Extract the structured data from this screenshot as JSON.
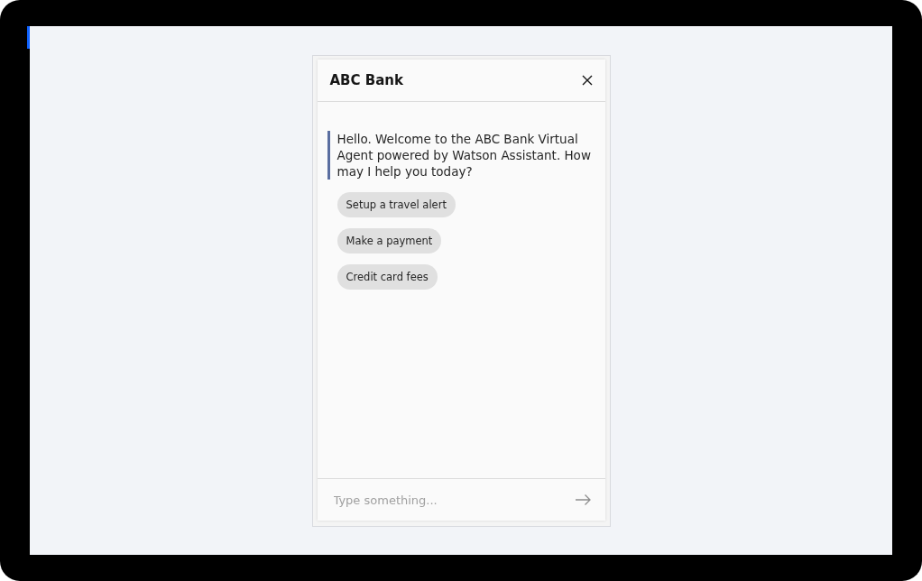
{
  "chat": {
    "title": "ABC Bank",
    "messages": [
      {
        "text": "Hello. Welcome to the ABC Bank Virtual Agent powered by Watson Assistant. How may I help you today?",
        "options": [
          "Setup a travel alert",
          "Make a payment",
          "Credit card fees"
        ]
      }
    ],
    "input": {
      "placeholder": "Type something..."
    }
  }
}
